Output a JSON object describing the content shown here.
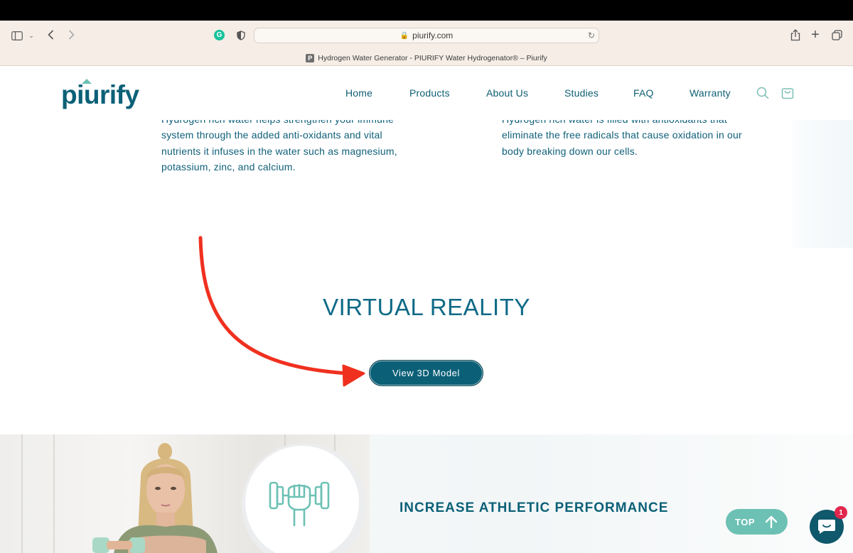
{
  "browser": {
    "url": "piurify.com",
    "tab_title": "Hydrogen Water Generator - PIURIFY Water Hydrogenator® – Piurify",
    "favicon_letter": "P",
    "extension_letter": "G"
  },
  "header": {
    "logo_text": "piurify",
    "nav": [
      "Home",
      "Products",
      "About Us",
      "Studies",
      "FAQ",
      "Warranty"
    ],
    "icons": [
      "search-icon",
      "cart-icon"
    ]
  },
  "benefits": {
    "left_partial_line": "Hydrogen rich water helps strengthen your immune",
    "left_lines": [
      "system through the added anti-oxidants and vital",
      "nutrients it infuses in the water such as magnesium,",
      "potassium, zinc, and calcium."
    ],
    "right_partial_line": "Hydrogen rich water is filled with antioxidants that",
    "right_lines": [
      "eliminate the free radicals that cause oxidation in our",
      "body breaking down our cells."
    ]
  },
  "vr": {
    "title": "VIRTUAL REALITY",
    "button_label": "View 3D Model"
  },
  "athletic": {
    "title": "INCREASE ATHLETIC PERFORMANCE",
    "icon": "fist-dumbbell-icon"
  },
  "floating": {
    "top_label": "TOP",
    "chat_badge_count": "1"
  },
  "colors": {
    "brand_teal": "#0b6077",
    "accent_mint": "#6cc1b4",
    "annotation_red": "#f0301f"
  }
}
